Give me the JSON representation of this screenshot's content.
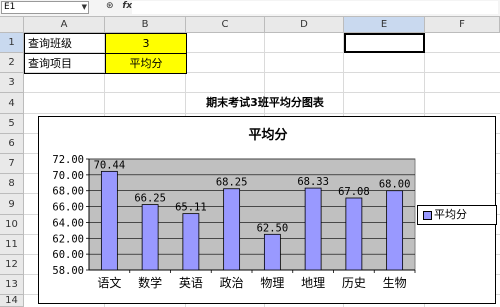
{
  "formula_bar": {
    "name_box": "E1",
    "icon_names": [
      "zoom-icon",
      "fx-icon"
    ],
    "fx_glyph": "fx",
    "zoom_glyph": "⊛",
    "content": ""
  },
  "columns": [
    "A",
    "B",
    "C",
    "D",
    "E",
    "F"
  ],
  "rows": [
    "1",
    "2",
    "3",
    "4",
    "5",
    "6",
    "7",
    "8",
    "9",
    "10",
    "11",
    "12",
    "13",
    "14"
  ],
  "cells": {
    "A1": "查询班级",
    "B1": "3",
    "A2": "查询项目",
    "B2": "平均分",
    "B4": "期末考试3班平均分图表"
  },
  "colors": {
    "highlight": "#ffff00",
    "bar_fill": "#9999ff",
    "plot_bg": "#c0c0c0"
  },
  "chart_data": {
    "type": "bar",
    "title": "平均分",
    "categories": [
      "语文",
      "数学",
      "英语",
      "政治",
      "物理",
      "地理",
      "历史",
      "生物"
    ],
    "series": [
      {
        "name": "平均分",
        "values": [
          70.44,
          66.25,
          65.11,
          68.25,
          62.5,
          68.33,
          67.08,
          68.0
        ]
      }
    ],
    "data_labels": [
      "70.44",
      "66.25",
      "65.11",
      "68.25",
      "62.50",
      "68.33",
      "67.08",
      "68.00"
    ],
    "yticks": [
      "72.00",
      "70.00",
      "68.00",
      "66.00",
      "64.00",
      "62.00",
      "60.00",
      "58.00"
    ],
    "ylim": [
      58,
      72
    ],
    "grid": true,
    "legend_position": "right"
  }
}
